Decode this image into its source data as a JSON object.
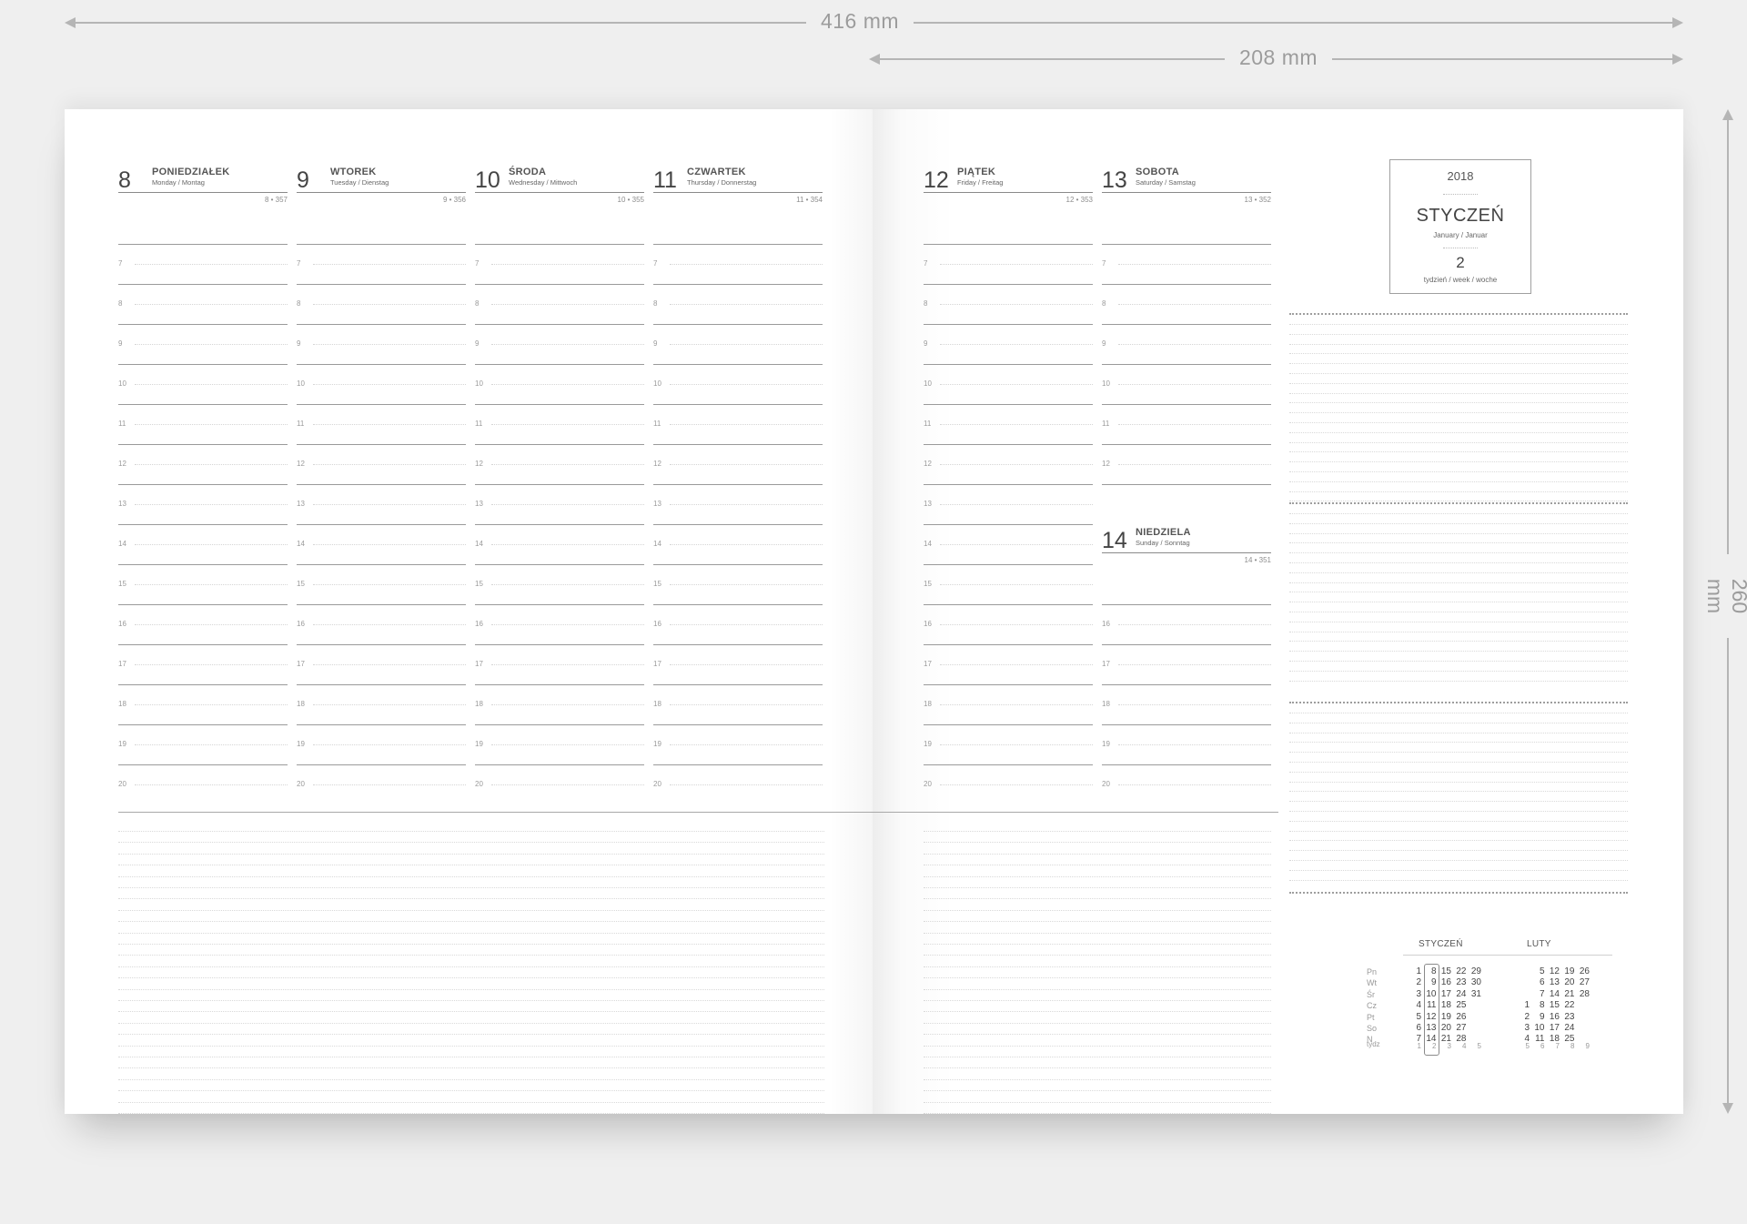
{
  "dimensions": {
    "width_label": "416 mm",
    "page_width_label": "208 mm",
    "height_label": "260 mm"
  },
  "left_page": {
    "days": [
      {
        "num": "8",
        "name": "PONIEDZIAŁEK",
        "sub": "Monday / Montag",
        "count": "8 • 357"
      },
      {
        "num": "9",
        "name": "WTOREK",
        "sub": "Tuesday / Dienstag",
        "count": "9 • 356"
      },
      {
        "num": "10",
        "name": "ŚRODA",
        "sub": "Wednesday / Mittwoch",
        "count": "10 • 355"
      },
      {
        "num": "11",
        "name": "CZWARTEK",
        "sub": "Thursday / Donnerstag",
        "count": "11 • 354"
      }
    ]
  },
  "right_page": {
    "days": [
      {
        "num": "12",
        "name": "PIĄTEK",
        "sub": "Friday / Freitag",
        "count": "12 • 353"
      },
      {
        "num": "13",
        "name": "SOBOTA",
        "sub": "Saturday / Samstag",
        "count": "13 • 352"
      },
      {
        "num": "14",
        "name": "NIEDZIELA",
        "sub": "Sunday / Sonntag",
        "count": "14 • 351"
      }
    ],
    "month_box": {
      "year": "2018",
      "month": "STYCZEŃ",
      "month_sub": "January / Januar",
      "week": "2",
      "week_sub": "tydzień / week / woche"
    }
  },
  "hours": [
    "7",
    "8",
    "9",
    "10",
    "11",
    "12",
    "13",
    "14",
    "15",
    "16",
    "17",
    "18",
    "19",
    "20"
  ],
  "mini_calendar": {
    "weekday_labels": [
      "Pn",
      "Wt",
      "Śr",
      "Cz",
      "Pt",
      "So",
      "N"
    ],
    "week_label": "tydz",
    "months": [
      {
        "title": "STYCZEŃ",
        "columns": [
          [
            "1",
            "2",
            "3",
            "4",
            "5",
            "6",
            "7"
          ],
          [
            "8",
            "9",
            "10",
            "11",
            "12",
            "13",
            "14"
          ],
          [
            "15",
            "16",
            "17",
            "18",
            "19",
            "20",
            "21"
          ],
          [
            "22",
            "23",
            "24",
            "25",
            "26",
            "27",
            "28"
          ],
          [
            "29",
            "30",
            "31",
            "",
            "",
            "",
            ""
          ]
        ],
        "weeks": [
          "1",
          "2",
          "3",
          "4",
          "5"
        ],
        "highlight_column": 1
      },
      {
        "title": "LUTY",
        "columns": [
          [
            "",
            "",
            "",
            "1",
            "2",
            "3",
            "4"
          ],
          [
            "5",
            "6",
            "7",
            "8",
            "9",
            "10",
            "11"
          ],
          [
            "12",
            "13",
            "14",
            "15",
            "16",
            "17",
            "18"
          ],
          [
            "19",
            "20",
            "21",
            "22",
            "23",
            "24",
            "25"
          ],
          [
            "26",
            "27",
            "28",
            "",
            "",
            "",
            ""
          ]
        ],
        "weeks": [
          "5",
          "6",
          "7",
          "8",
          "9"
        ]
      }
    ]
  },
  "colors": {
    "background": "#efefef",
    "page": "#ffffff",
    "rule": "#9a9a9a",
    "dimension": "#b5b5b5"
  }
}
